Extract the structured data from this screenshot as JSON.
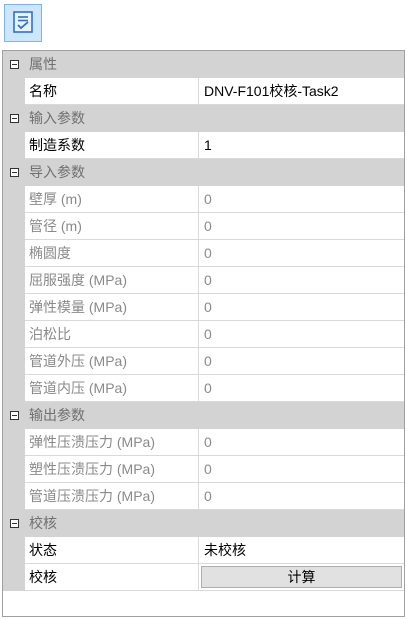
{
  "toolbar": {
    "icon": "checklist-icon"
  },
  "colors": {
    "category_bg": "#d3d3d3",
    "toolbar_btn_bg": "#cde6fb",
    "toolbar_btn_border": "#7ab6ea",
    "readonly_text": "#8a8a8a"
  },
  "categories": {
    "properties": {
      "label": "属性",
      "rows": {
        "name": {
          "label": "名称",
          "value": "DNV-F101校核-Task2"
        }
      }
    },
    "input": {
      "label": "输入参数",
      "rows": {
        "factor": {
          "label": "制造系数",
          "value": "1"
        }
      }
    },
    "imported": {
      "label": "导入参数",
      "rows": {
        "wall": {
          "label": "壁厚 (m)",
          "value": "0"
        },
        "diameter": {
          "label": "管径 (m)",
          "value": "0"
        },
        "ovality": {
          "label": "椭圆度",
          "value": "0"
        },
        "yield": {
          "label": "屈服强度 (MPa)",
          "value": "0"
        },
        "modulus": {
          "label": "弹性模量 (MPa)",
          "value": "0"
        },
        "poisson": {
          "label": "泊松比",
          "value": "0"
        },
        "ext_pressure": {
          "label": "管道外压 (MPa)",
          "value": "0"
        },
        "int_pressure": {
          "label": "管道内压 (MPa)",
          "value": "0"
        }
      }
    },
    "output": {
      "label": "输出参数",
      "rows": {
        "elastic": {
          "label": "弹性压溃压力 (MPa)",
          "value": "0"
        },
        "plastic": {
          "label": "塑性压溃压力 (MPa)",
          "value": "0"
        },
        "collapse": {
          "label": "管道压溃压力 (MPa)",
          "value": "0"
        }
      }
    },
    "check": {
      "label": "校核",
      "rows": {
        "status": {
          "label": "状态",
          "value": "未校核"
        },
        "check": {
          "label": "校核",
          "button": "计算"
        }
      }
    }
  }
}
